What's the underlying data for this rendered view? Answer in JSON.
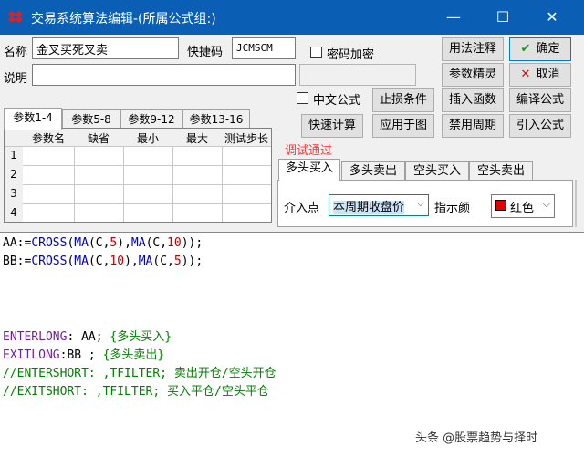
{
  "window": {
    "title": "交易系统算法编辑-(所属公式组:)",
    "minimize": "—",
    "maximize": "☐",
    "close": "✕"
  },
  "form": {
    "name_label": "名称",
    "name_value": "金叉买死叉卖",
    "shortcut_label": "快捷码",
    "shortcut_value": "JCMSCM",
    "password_label": "密码加密",
    "desc_label": "说明",
    "desc_value": "",
    "chinese_label": "中文公式"
  },
  "buttons": {
    "usage_note": "用法注释",
    "confirm": "确定",
    "param_tune": "参数精灵",
    "cancel": "取消",
    "stop_loss": "止损条件",
    "insert_func": "插入函数",
    "compile": "编译公式",
    "quick_calc": "快速计算",
    "apply_chart": "应用于图",
    "disable_period": "禁用周期",
    "import_formula": "引入公式"
  },
  "param_tabs": [
    "参数1-4",
    "参数5-8",
    "参数9-12",
    "参数13-16"
  ],
  "param_table": {
    "headers": [
      "参数名",
      "缺省",
      "最小",
      "最大",
      "测试步长"
    ],
    "rows": [
      "1",
      "2",
      "3",
      "4"
    ]
  },
  "status": "调试通过",
  "signal_tabs": [
    "多头买入",
    "多头卖出",
    "空头买入",
    "空头卖出"
  ],
  "signal": {
    "entry_label": "介入点",
    "entry_value": "本周期收盘价",
    "indicator_label": "指示颜",
    "color_value": "红色"
  },
  "code": {
    "line1": {
      "a": "AA:=",
      "fn": "CROSS",
      "b": "(",
      "ma1": "MA",
      "c": "(C,",
      "n1": "5",
      "d": "),",
      "ma2": "MA",
      "e": "(C,",
      "n2": "10",
      "f": "));"
    },
    "line2": {
      "a": "BB:=",
      "fn": "CROSS",
      "b": "(",
      "ma1": "MA",
      "c": "(C,",
      "n1": "10",
      "d": "),",
      "ma2": "MA",
      "e": "(C,",
      "n2": "5",
      "f": "));"
    },
    "line3": {
      "kw": "ENTERLONG",
      "rest": ": AA; ",
      "cm": "{多头买入}"
    },
    "line4": {
      "kw": "EXITLONG",
      "rest": ":BB ; ",
      "cm": "{多头卖出}"
    },
    "line5": "//ENTERSHORT: ,TFILTER; 卖出开仓/空头开仓",
    "line6": "//EXITSHORT: ,TFILTER; 买入平仓/空头平仓"
  },
  "watermark": "头条 @股票趋势与择时",
  "colors": {
    "titlebar": "#0a5fb4",
    "status": "#ff3030",
    "keyword": "#0000c0",
    "number": "#c00000"
  }
}
